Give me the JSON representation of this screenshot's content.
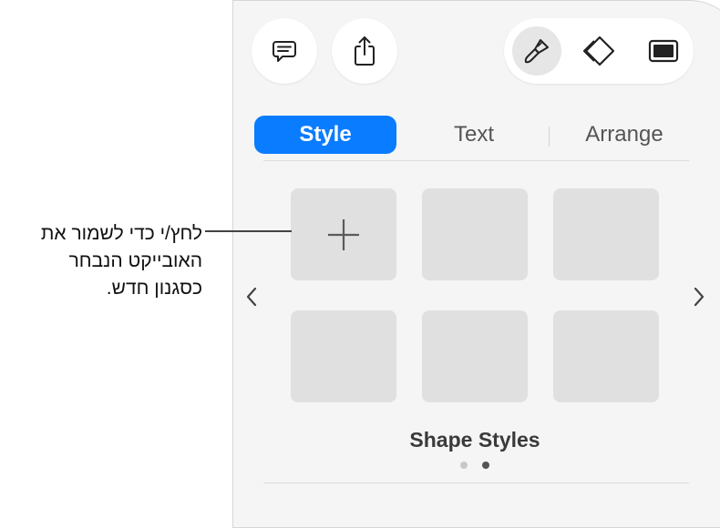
{
  "toolbar": {
    "comment_icon": "comment-icon",
    "share_icon": "share-icon",
    "format_icon": "paintbrush-icon",
    "animate_icon": "diamond-icon",
    "document_icon": "document-icon"
  },
  "tabs": [
    {
      "label": "Style",
      "active": true
    },
    {
      "label": "Text",
      "active": false
    },
    {
      "label": "Arrange",
      "active": false
    }
  ],
  "styles_grid": {
    "add_icon": "plus-icon",
    "title": "Shape Styles",
    "page_count": 2,
    "current_page": 2,
    "prev_icon": "chevron-left-icon",
    "next_icon": "chevron-right-icon"
  },
  "callout": {
    "lines": [
      "לחץ/י כדי לשמור את",
      "האובייקט הנבחר",
      "כסגנון חדש."
    ]
  },
  "colors": {
    "accent": "#0a7cff",
    "panel_bg": "#f5f5f5",
    "tile_bg": "#e0e0e0"
  }
}
